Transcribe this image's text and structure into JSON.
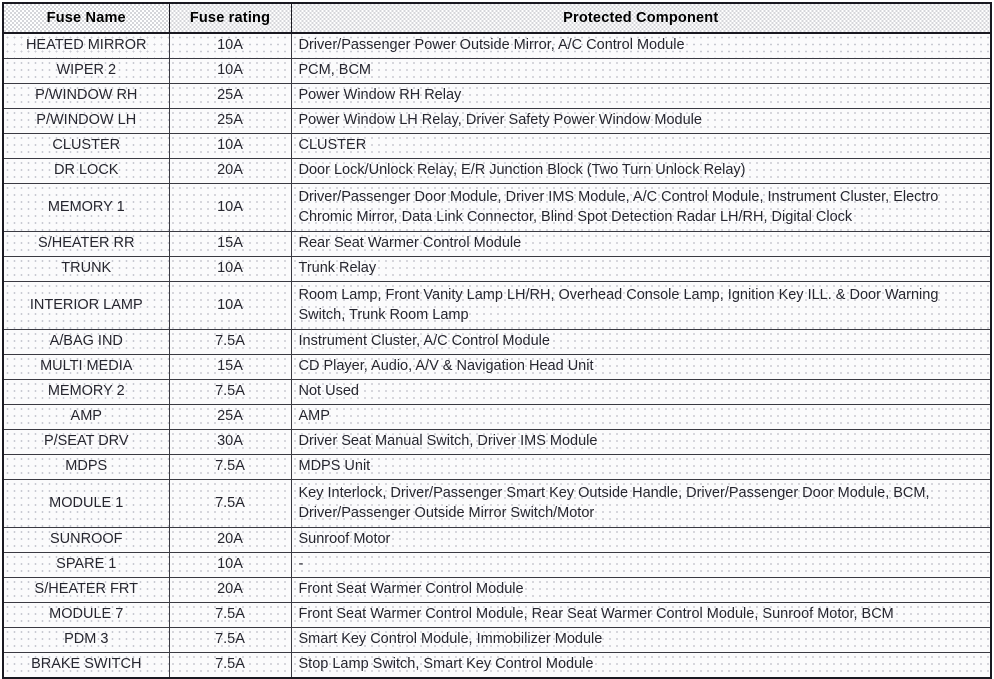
{
  "table": {
    "headers": [
      {
        "label": "Fuse Name",
        "name": "header-fuse-name"
      },
      {
        "label": "Fuse rating",
        "name": "header-fuse-rating"
      },
      {
        "label": "Protected Component",
        "name": "header-protected-component"
      }
    ],
    "rows": [
      {
        "fuse_name": "HEATED MIRROR",
        "fuse_rating": "10A",
        "protected_component": "Driver/Passenger Power Outside Mirror, A/C Control Module",
        "tall": false
      },
      {
        "fuse_name": "WIPER 2",
        "fuse_rating": "10A",
        "protected_component": "PCM, BCM",
        "tall": false
      },
      {
        "fuse_name": "P/WINDOW RH",
        "fuse_rating": "25A",
        "protected_component": "Power Window RH Relay",
        "tall": false
      },
      {
        "fuse_name": "P/WINDOW LH",
        "fuse_rating": "25A",
        "protected_component": "Power Window LH Relay, Driver Safety Power Window Module",
        "tall": false
      },
      {
        "fuse_name": "CLUSTER",
        "fuse_rating": "10A",
        "protected_component": "CLUSTER",
        "tall": false
      },
      {
        "fuse_name": "DR LOCK",
        "fuse_rating": "20A",
        "protected_component": "Door Lock/Unlock Relay, E/R Junction Block (Two Turn Unlock Relay)",
        "tall": false
      },
      {
        "fuse_name": "MEMORY 1",
        "fuse_rating": "10A",
        "protected_component": "Driver/Passenger Door Module, Driver IMS Module, A/C Control Module, Instrument Cluster, Electro Chromic Mirror, Data Link Connector, Blind Spot Detection Radar LH/RH, Digital Clock",
        "tall": true
      },
      {
        "fuse_name": "S/HEATER RR",
        "fuse_rating": "15A",
        "protected_component": "Rear Seat Warmer Control Module",
        "tall": false
      },
      {
        "fuse_name": "TRUNK",
        "fuse_rating": "10A",
        "protected_component": "Trunk Relay",
        "tall": false
      },
      {
        "fuse_name": "INTERIOR LAMP",
        "fuse_rating": "10A",
        "protected_component": "Room Lamp, Front Vanity Lamp LH/RH, Overhead Console Lamp, Ignition Key ILL. & Door Warning Switch, Trunk Room Lamp",
        "tall": true
      },
      {
        "fuse_name": "A/BAG IND",
        "fuse_rating": "7.5A",
        "protected_component": "Instrument Cluster, A/C Control Module",
        "tall": false
      },
      {
        "fuse_name": "MULTI MEDIA",
        "fuse_rating": "15A",
        "protected_component": "CD Player, Audio, A/V & Navigation Head Unit",
        "tall": false
      },
      {
        "fuse_name": "MEMORY 2",
        "fuse_rating": "7.5A",
        "protected_component": "Not Used",
        "tall": false
      },
      {
        "fuse_name": "AMP",
        "fuse_rating": "25A",
        "protected_component": "AMP",
        "tall": false
      },
      {
        "fuse_name": "P/SEAT DRV",
        "fuse_rating": "30A",
        "protected_component": "Driver Seat Manual Switch, Driver IMS Module",
        "tall": false
      },
      {
        "fuse_name": "MDPS",
        "fuse_rating": "7.5A",
        "protected_component": "MDPS Unit",
        "tall": false
      },
      {
        "fuse_name": "MODULE 1",
        "fuse_rating": "7.5A",
        "protected_component": "Key Interlock, Driver/Passenger Smart Key Outside Handle, Driver/Passenger Door Module, BCM, Driver/Passenger Outside Mirror Switch/Motor",
        "tall": true
      },
      {
        "fuse_name": "SUNROOF",
        "fuse_rating": "20A",
        "protected_component": "Sunroof Motor",
        "tall": false
      },
      {
        "fuse_name": "SPARE 1",
        "fuse_rating": "10A",
        "protected_component": "-",
        "tall": false
      },
      {
        "fuse_name": "S/HEATER FRT",
        "fuse_rating": "20A",
        "protected_component": "Front Seat Warmer Control Module",
        "tall": false
      },
      {
        "fuse_name": "MODULE 7",
        "fuse_rating": "7.5A",
        "protected_component": "Front Seat Warmer Control Module, Rear Seat Warmer Control Module, Sunroof Motor, BCM",
        "tall": false
      },
      {
        "fuse_name": "PDM 3",
        "fuse_rating": "7.5A",
        "protected_component": "Smart Key Control Module, Immobilizer Module",
        "tall": false
      },
      {
        "fuse_name": "BRAKE SWITCH",
        "fuse_rating": "7.5A",
        "protected_component": "Stop Lamp Switch, Smart Key Control Module",
        "tall": false
      }
    ]
  },
  "colors": {
    "border": "#191820",
    "header_text": "#000000",
    "body_text": "#26262f",
    "header_fill": "#d5d6da",
    "body_fill": "#fbfbfc"
  }
}
